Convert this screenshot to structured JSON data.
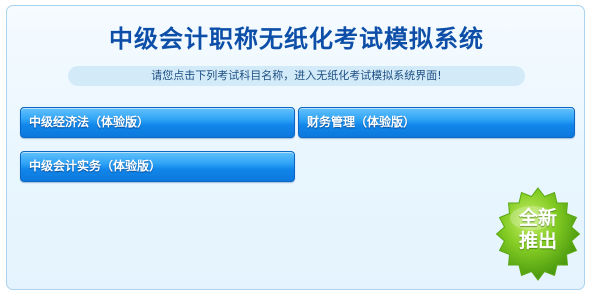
{
  "header": {
    "title": "中级会计职称无纸化考试模拟系统"
  },
  "notice": {
    "text": "请您点击下列考试科目名称，进入无纸化考试模拟系统界面!"
  },
  "courses": [
    {
      "label": "中级经济法（体验版）"
    },
    {
      "label": "财务管理（体验版）"
    },
    {
      "label": "中级会计实务（体验版）"
    }
  ],
  "badge": {
    "line1": "全新",
    "line2": "推出",
    "color": "#6fbf1a"
  },
  "colors": {
    "title": "#0d4fa8",
    "button": "#1a8cf0",
    "panel_border": "#a9d3ef"
  }
}
